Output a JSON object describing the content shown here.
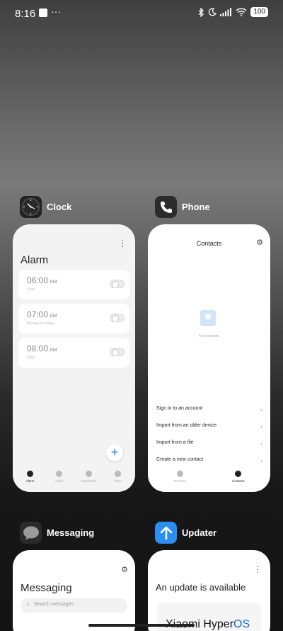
{
  "status_bar": {
    "time": "8:16",
    "dots": "···",
    "battery": "100",
    "icons": [
      "bluetooth-icon",
      "moon-icon",
      "signal-icon",
      "wifi-icon",
      "battery-icon"
    ]
  },
  "apps": {
    "clock": {
      "name": "Clock",
      "screen_title": "Alarm",
      "alarms": [
        {
          "time": "06:00",
          "ampm": "AM",
          "sub": "Once"
        },
        {
          "time": "07:00",
          "ampm": "AM",
          "sub": "Monday to Friday"
        },
        {
          "time": "08:00",
          "ampm": "AM",
          "sub": "Daily"
        }
      ],
      "nav": [
        "Alarm",
        "Clock",
        "Stopwatch",
        "Timer"
      ]
    },
    "phone": {
      "name": "Phone",
      "screen_title": "Contacts",
      "empty_text": "No contacts",
      "actions": [
        "Sign in to an account",
        "Import from an older device",
        "Import from a file",
        "Create a new contact"
      ],
      "nav": [
        "Recents",
        "Contacts"
      ]
    },
    "messaging": {
      "name": "Messaging",
      "screen_title": "Messaging",
      "search_placeholder": "Search messages"
    },
    "updater": {
      "name": "Updater",
      "screen_title": "An update is available",
      "brand": "Xiaomi Hyper",
      "brand_suffix": "OS"
    }
  },
  "colors": {
    "accent": "#1e88e5",
    "updater_icon": "#2b8ef0"
  }
}
